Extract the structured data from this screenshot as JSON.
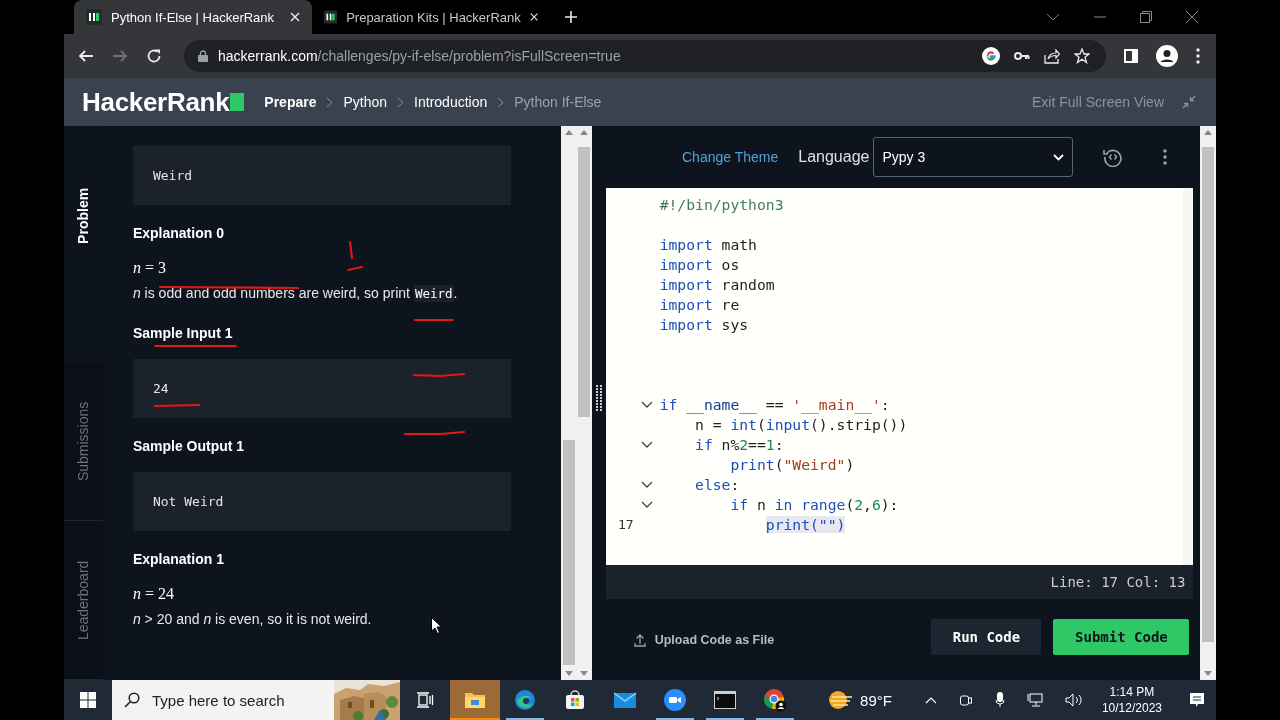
{
  "browser": {
    "tabs": [
      {
        "title": "Python If-Else | HackerRank",
        "selected": true
      },
      {
        "title": "Preparation Kits | HackerRank",
        "selected": false
      }
    ],
    "address": {
      "host": "hackerrank.com",
      "path": "/challenges/py-if-else/problem?isFullScreen=true"
    },
    "forward_disabled": true
  },
  "header": {
    "logo": "HackerRank",
    "breadcrumbs": [
      {
        "label": "Prepare",
        "current": false
      },
      {
        "label": "Python",
        "current": false
      },
      {
        "label": "Introduction",
        "current": false
      },
      {
        "label": "Python If-Else",
        "current": true
      }
    ],
    "exit_label": "Exit Full Screen View"
  },
  "side_tabs": [
    {
      "label": "Problem",
      "selected": true
    },
    {
      "label": "Submissions",
      "selected": false
    },
    {
      "label": "Leaderboard",
      "selected": false
    }
  ],
  "problem": [
    {
      "kind": "code_block",
      "text": "Weird"
    },
    {
      "kind": "heading",
      "text": "Explanation 0"
    },
    {
      "kind": "math",
      "text": "*n* = 3"
    },
    {
      "kind": "paragraph",
      "parts": [
        {
          "kind": "text",
          "text": "*n* is odd and odd numbers are weird, so print "
        },
        {
          "kind": "code",
          "text": "Weird"
        },
        {
          "kind": "text",
          "text": "."
        }
      ]
    },
    {
      "kind": "heading",
      "text": "Sample Input 1"
    },
    {
      "kind": "code_block",
      "text": "24"
    },
    {
      "kind": "heading",
      "text": "Sample Output 1"
    },
    {
      "kind": "code_block",
      "text": "Not Weird"
    },
    {
      "kind": "heading",
      "text": "Explanation 1"
    },
    {
      "kind": "math",
      "text": "*n* = 24"
    },
    {
      "kind": "paragraph",
      "parts": [
        {
          "kind": "text",
          "text": "*n* > 20 and *n* is even, so it is not weird."
        }
      ]
    }
  ],
  "editor": {
    "change_theme": "Change Theme",
    "language_label": "Language",
    "language": "Pypy 3",
    "lines": [
      {
        "fold": false,
        "tokens": [
          {
            "t": "#!/bin/python3",
            "kind": "comment"
          }
        ]
      },
      {
        "fold": false
      },
      {
        "fold": false,
        "tokens": [
          {
            "t": "import",
            "kind": "keyword"
          },
          {
            "t": " math",
            "kind": "plain"
          }
        ]
      },
      {
        "fold": false,
        "tokens": [
          {
            "t": "import",
            "kind": "keyword"
          },
          {
            "t": " os",
            "kind": "plain"
          }
        ]
      },
      {
        "fold": false,
        "tokens": [
          {
            "t": "import",
            "kind": "keyword"
          },
          {
            "t": " random",
            "kind": "plain"
          }
        ]
      },
      {
        "fold": false,
        "tokens": [
          {
            "t": "import",
            "kind": "keyword"
          },
          {
            "t": " re",
            "kind": "plain"
          }
        ]
      },
      {
        "fold": false,
        "tokens": [
          {
            "t": "import",
            "kind": "keyword"
          },
          {
            "t": " sys",
            "kind": "plain"
          }
        ]
      },
      {
        "fold": false
      },
      {
        "fold": false
      },
      {
        "fold": false
      },
      {
        "fold": true,
        "tokens": [
          {
            "t": "if",
            "kind": "keyword"
          },
          {
            "t": " __name__",
            "kind": "variable"
          },
          {
            "t": " == ",
            "kind": "plain"
          },
          {
            "t": "'__main__'",
            "kind": "string"
          },
          {
            "t": ":",
            "kind": "plain"
          }
        ]
      },
      {
        "fold": false,
        "tokens": [
          {
            "t": "    n = ",
            "kind": "plain"
          },
          {
            "t": "int",
            "kind": "builtin"
          },
          {
            "t": "(",
            "kind": "plain"
          },
          {
            "t": "input",
            "kind": "builtin"
          },
          {
            "t": "().strip())",
            "kind": "plain"
          }
        ]
      },
      {
        "fold": true,
        "tokens": [
          {
            "t": "    if",
            "kind": "keyword"
          },
          {
            "t": " n%",
            "kind": "plain"
          },
          {
            "t": "2",
            "kind": "number"
          },
          {
            "t": "==",
            "kind": "plain"
          },
          {
            "t": "1",
            "kind": "number"
          },
          {
            "t": ":",
            "kind": "plain"
          }
        ]
      },
      {
        "fold": false,
        "tokens": [
          {
            "t": "        print",
            "kind": "builtin"
          },
          {
            "t": "(",
            "kind": "plain"
          },
          {
            "t": "\"Weird\"",
            "kind": "string"
          },
          {
            "t": ")",
            "kind": "plain"
          }
        ]
      },
      {
        "fold": true,
        "tokens": [
          {
            "t": "    else",
            "kind": "keyword"
          },
          {
            "t": ":",
            "kind": "plain"
          }
        ]
      },
      {
        "fold": true,
        "tokens": [
          {
            "t": "        if",
            "kind": "keyword"
          },
          {
            "t": " n ",
            "kind": "plain"
          },
          {
            "t": "in",
            "kind": "keyword"
          },
          {
            "t": " range",
            "kind": "builtin"
          },
          {
            "t": "(",
            "kind": "plain"
          },
          {
            "t": "2",
            "kind": "number"
          },
          {
            "t": ",",
            "kind": "plain"
          },
          {
            "t": "6",
            "kind": "number"
          },
          {
            "t": "):",
            "kind": "plain"
          }
        ]
      },
      {
        "fold": false,
        "number": "17",
        "tokens": [
          {
            "t": "            print(\"\")",
            "kind": "selection"
          }
        ]
      }
    ],
    "status": "Line: 17 Col: 13",
    "upload": "Upload Code as File",
    "run": "Run Code",
    "submit": "Submit Code"
  },
  "taskbar": {
    "search_placeholder": "Type here to search",
    "apps": [
      {
        "kind": "task-view",
        "selected": false,
        "running": false
      },
      {
        "kind": "folder",
        "selected": true,
        "running": true
      },
      {
        "kind": "edge",
        "selected": false,
        "running": true
      },
      {
        "kind": "store",
        "selected": false,
        "running": false
      },
      {
        "kind": "mail",
        "selected": false,
        "running": false
      },
      {
        "kind": "zoom",
        "selected": false,
        "running": true
      },
      {
        "kind": "terminal",
        "selected": false,
        "running": true
      },
      {
        "kind": "chrome",
        "selected": false,
        "running": true
      }
    ],
    "weather": "89°F",
    "time": "1:14 PM",
    "date": "10/12/2023"
  }
}
